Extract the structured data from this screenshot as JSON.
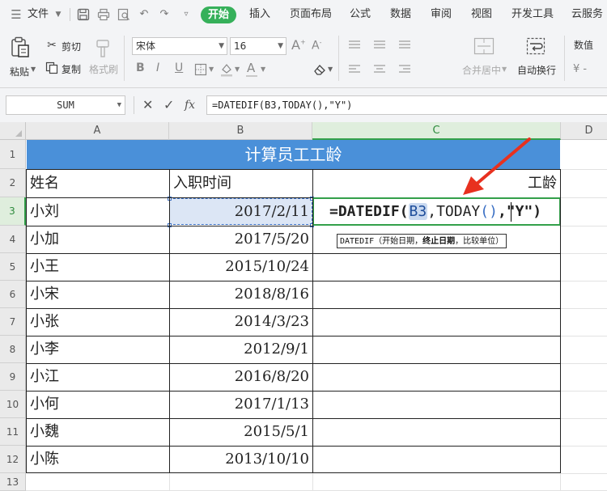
{
  "menu": {
    "file": "文件",
    "tabs": [
      "开始",
      "插入",
      "页面布局",
      "公式",
      "数据",
      "审阅",
      "视图",
      "开发工具",
      "云服务"
    ]
  },
  "ribbon": {
    "paste": "粘贴",
    "cut": "剪切",
    "copy": "复制",
    "format_painter": "格式刷",
    "font_name": "宋体",
    "font_size": "16",
    "merge_center": "合并居中",
    "wrap_text": "自动换行",
    "number_format": "数值"
  },
  "formula_bar": {
    "name_box": "SUM",
    "fx": "fx",
    "formula": "=DATEDIF(B3,TODAY(),\"Y\")"
  },
  "grid": {
    "columns": [
      "A",
      "B",
      "C",
      "D"
    ],
    "rows": [
      "1",
      "2",
      "3",
      "4",
      "5",
      "6",
      "7",
      "8",
      "9",
      "10",
      "11",
      "12",
      "13"
    ],
    "title": "计算员工工龄",
    "headers": {
      "name": "姓名",
      "hire_date": "入职时间",
      "seniority": "工龄"
    },
    "records": [
      {
        "name": "小刘",
        "date": "2017/2/11"
      },
      {
        "name": "小加",
        "date": "2017/5/20"
      },
      {
        "name": "小王",
        "date": "2015/10/24"
      },
      {
        "name": "小宋",
        "date": "2018/8/16"
      },
      {
        "name": "小张",
        "date": "2014/3/23"
      },
      {
        "name": "小李",
        "date": "2012/9/1"
      },
      {
        "name": "小江",
        "date": "2016/8/20"
      },
      {
        "name": "小何",
        "date": "2017/1/13"
      },
      {
        "name": "小魏",
        "date": "2015/5/1"
      },
      {
        "name": "小陈",
        "date": "2013/10/10"
      }
    ],
    "editing": {
      "prefix": "=DATEDIF(",
      "ref": "B3",
      "mid": ",TODAY",
      "parens": "()",
      "suffix": ",\"Y\")"
    },
    "tooltip": {
      "fn": "DATEDIF（开始日期，",
      "bold": "终止日期",
      "rest": "，比较单位）"
    }
  },
  "colors": {
    "accent_green": "#36b05a",
    "title_blue": "#4a90d9",
    "arrow_red": "#e8311f"
  }
}
